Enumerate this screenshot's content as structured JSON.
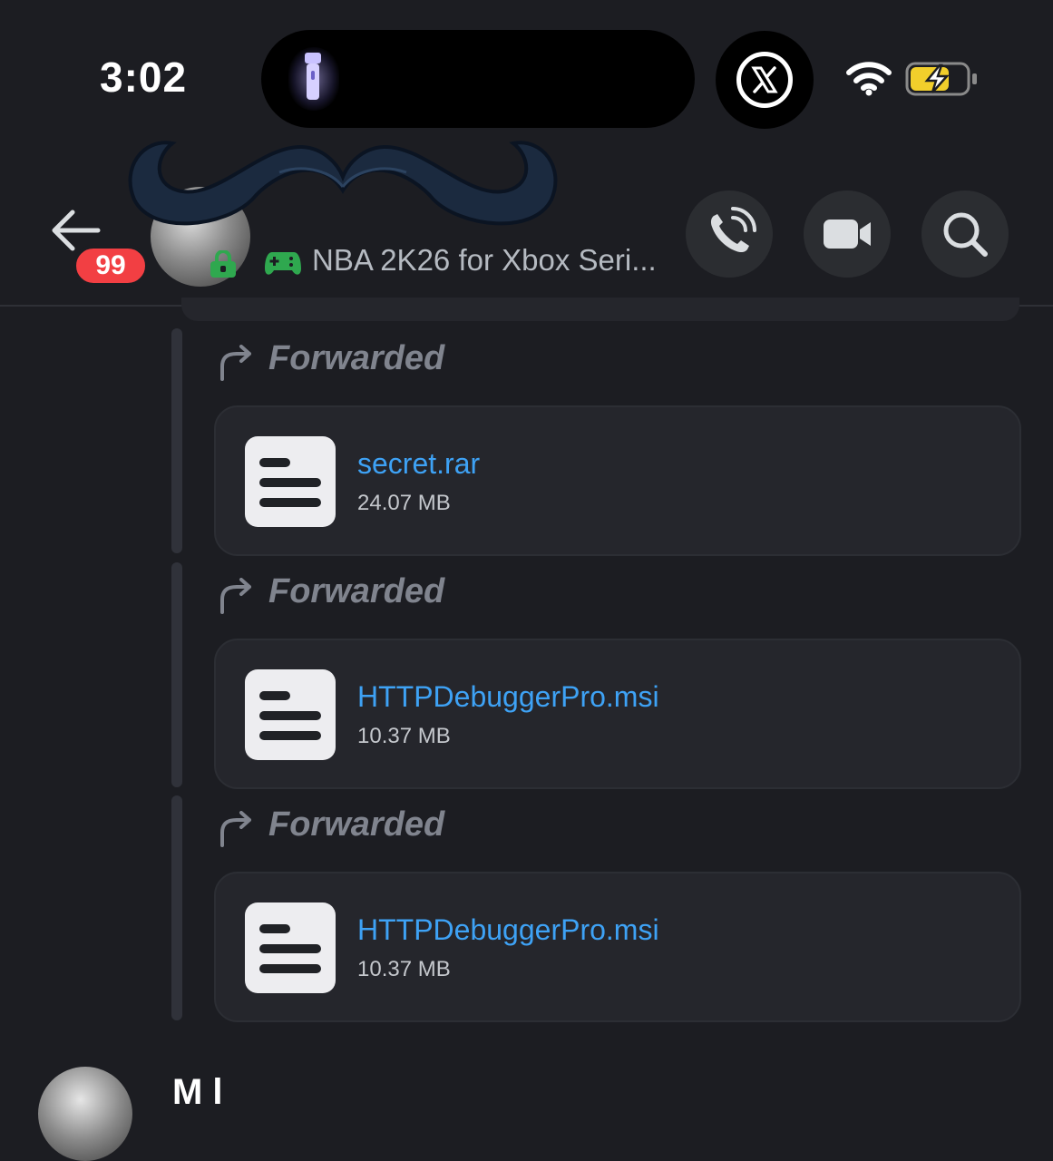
{
  "status_bar": {
    "time": "3:02"
  },
  "header": {
    "unread_badge": "99",
    "activity_status": "NBA 2K26 for Xbox Seri...",
    "call_button": "phone-icon",
    "video_button": "video-camera-icon",
    "search_button": "search-icon"
  },
  "messages": [
    {
      "forward_label": "Forwarded",
      "file_name": "secret.rar",
      "file_size": "24.07 MB"
    },
    {
      "forward_label": "Forwarded",
      "file_name": "HTTPDebuggerPro.msi",
      "file_size": "10.37 MB"
    },
    {
      "forward_label": "Forwarded",
      "file_name": "HTTPDebuggerPro.msi",
      "file_size": "10.37 MB"
    }
  ],
  "next_message": {
    "author": "M l"
  },
  "colors": {
    "background": "#1c1d22",
    "card": "#25262c",
    "link": "#3ea2f5",
    "badge": "#f23f43",
    "muted": "#80848e"
  }
}
